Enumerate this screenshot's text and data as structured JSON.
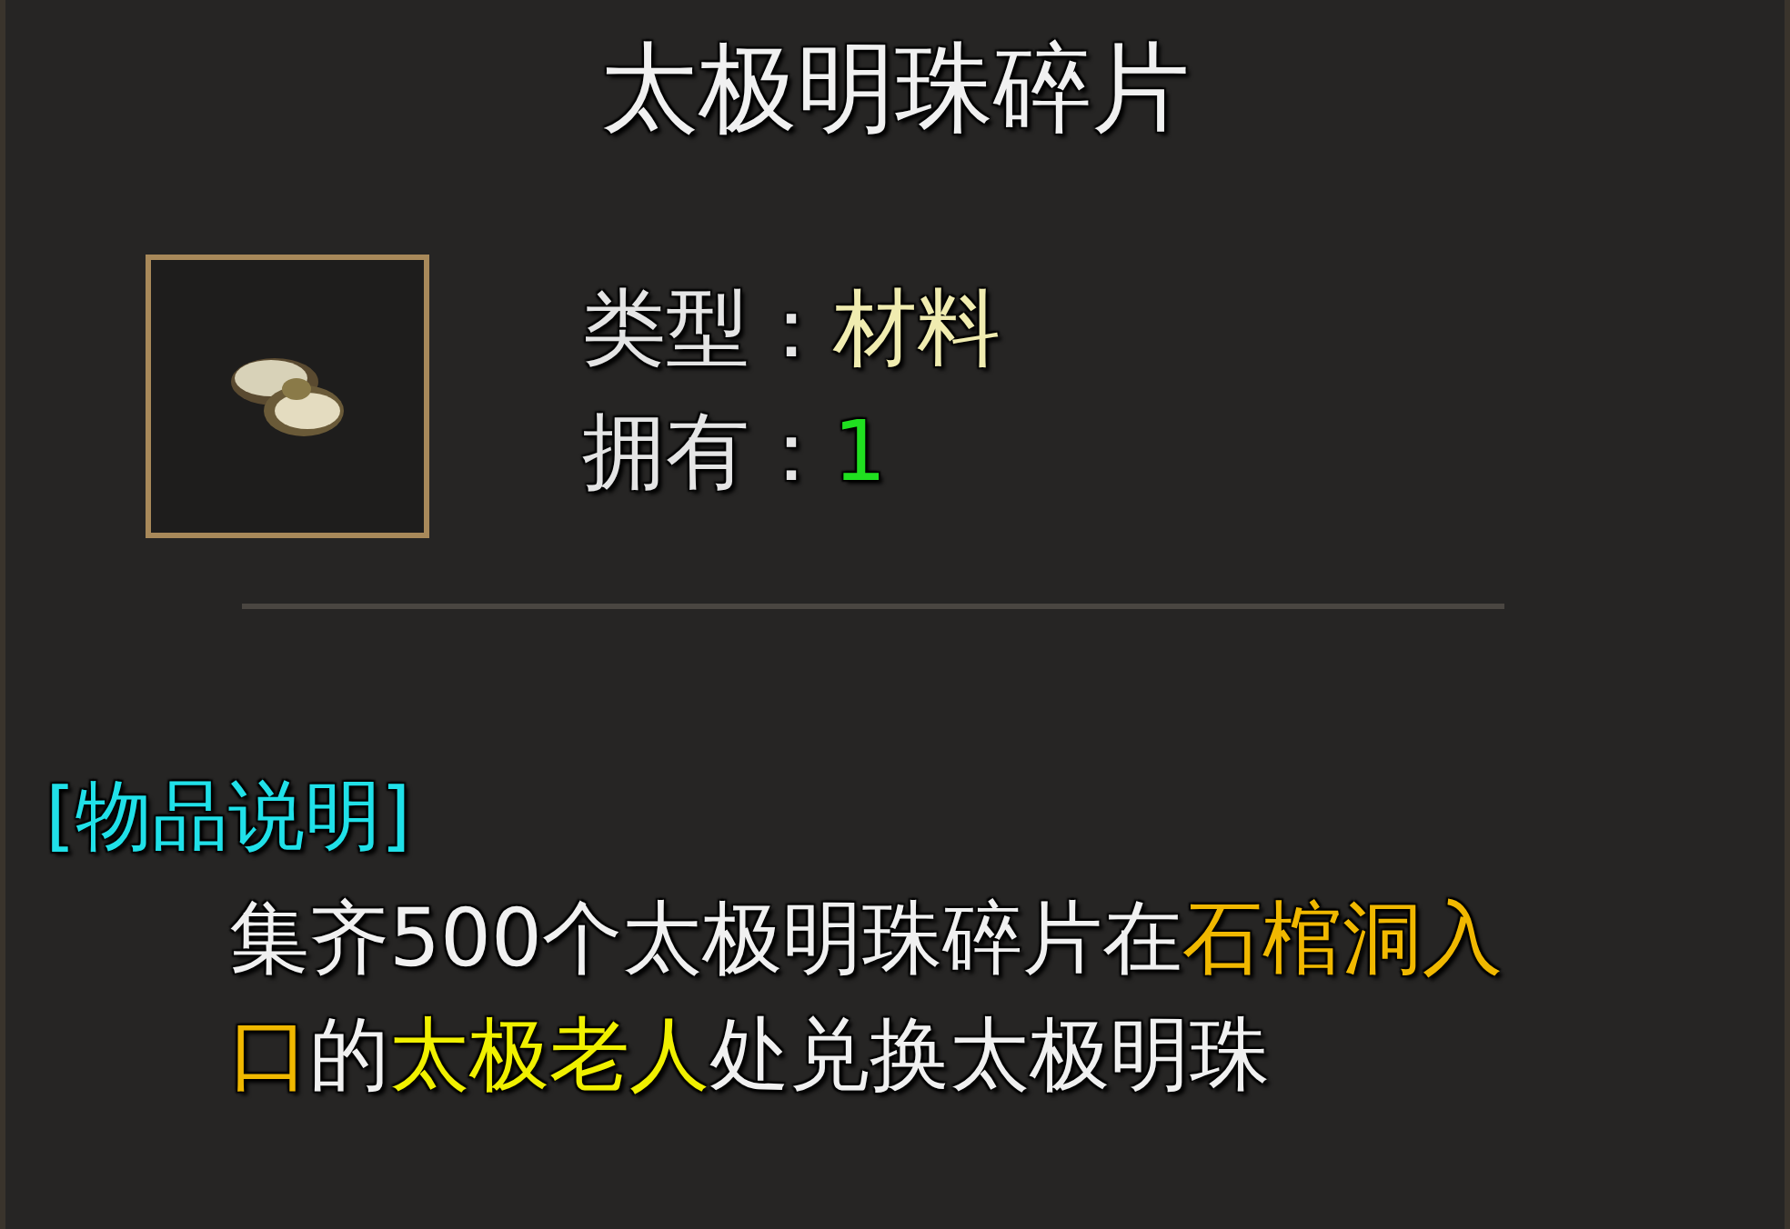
{
  "item": {
    "title": "太极明珠碎片",
    "kind": "picture",
    "attributes": [
      {
        "label": "类型：",
        "value": "材料",
        "color": "#f0ecb0"
      },
      {
        "label": "拥有：",
        "value": "1",
        "color": "#20e020"
      }
    ]
  },
  "description": {
    "header": "[物品说明]",
    "segments": [
      {
        "text": "集齐500个太极明珠碎片在",
        "color": "#f0f0f0"
      },
      {
        "text": "石棺洞入口",
        "color": "#f0b800"
      },
      {
        "text": "的",
        "color": "#f0f0f0"
      },
      {
        "text": "太极老人",
        "color": "#f0f000"
      },
      {
        "text": "处兑换太极明珠",
        "color": "#f0f0f0"
      }
    ]
  }
}
